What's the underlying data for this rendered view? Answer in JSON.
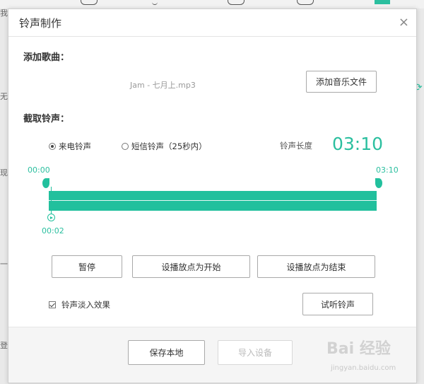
{
  "background": {
    "side_labels": [
      "我",
      "无",
      "现",
      "一",
      "登"
    ]
  },
  "dialog": {
    "title": "铃声制作",
    "close_glyph": "×",
    "add_song": {
      "section_title": "添加歌曲：",
      "file_name": "Jam - 七月上.mp3",
      "add_button": "添加音乐文件"
    },
    "cut": {
      "section_title": "截取铃声：",
      "options": [
        {
          "label": "来电铃声",
          "selected": true
        },
        {
          "label": "短信铃声（25秒内）",
          "selected": false
        }
      ],
      "length_label": "铃声长度",
      "length_value": "03:10",
      "start_time": "00:00",
      "end_time": "03:10",
      "play_time": "00:02",
      "buttons": {
        "pause": "暂停",
        "set_start": "设播放点为开始",
        "set_end": "设播放点为结束",
        "preview": "试听铃声"
      },
      "fade_label": "铃声淡入效果",
      "fade_checked": true
    },
    "footer": {
      "save": "保存本地",
      "import": "导入设备"
    }
  },
  "watermark": {
    "logo": "Bai 经验",
    "url": "jingyan.baidu.com"
  },
  "colors": {
    "accent": "#22c09d"
  }
}
